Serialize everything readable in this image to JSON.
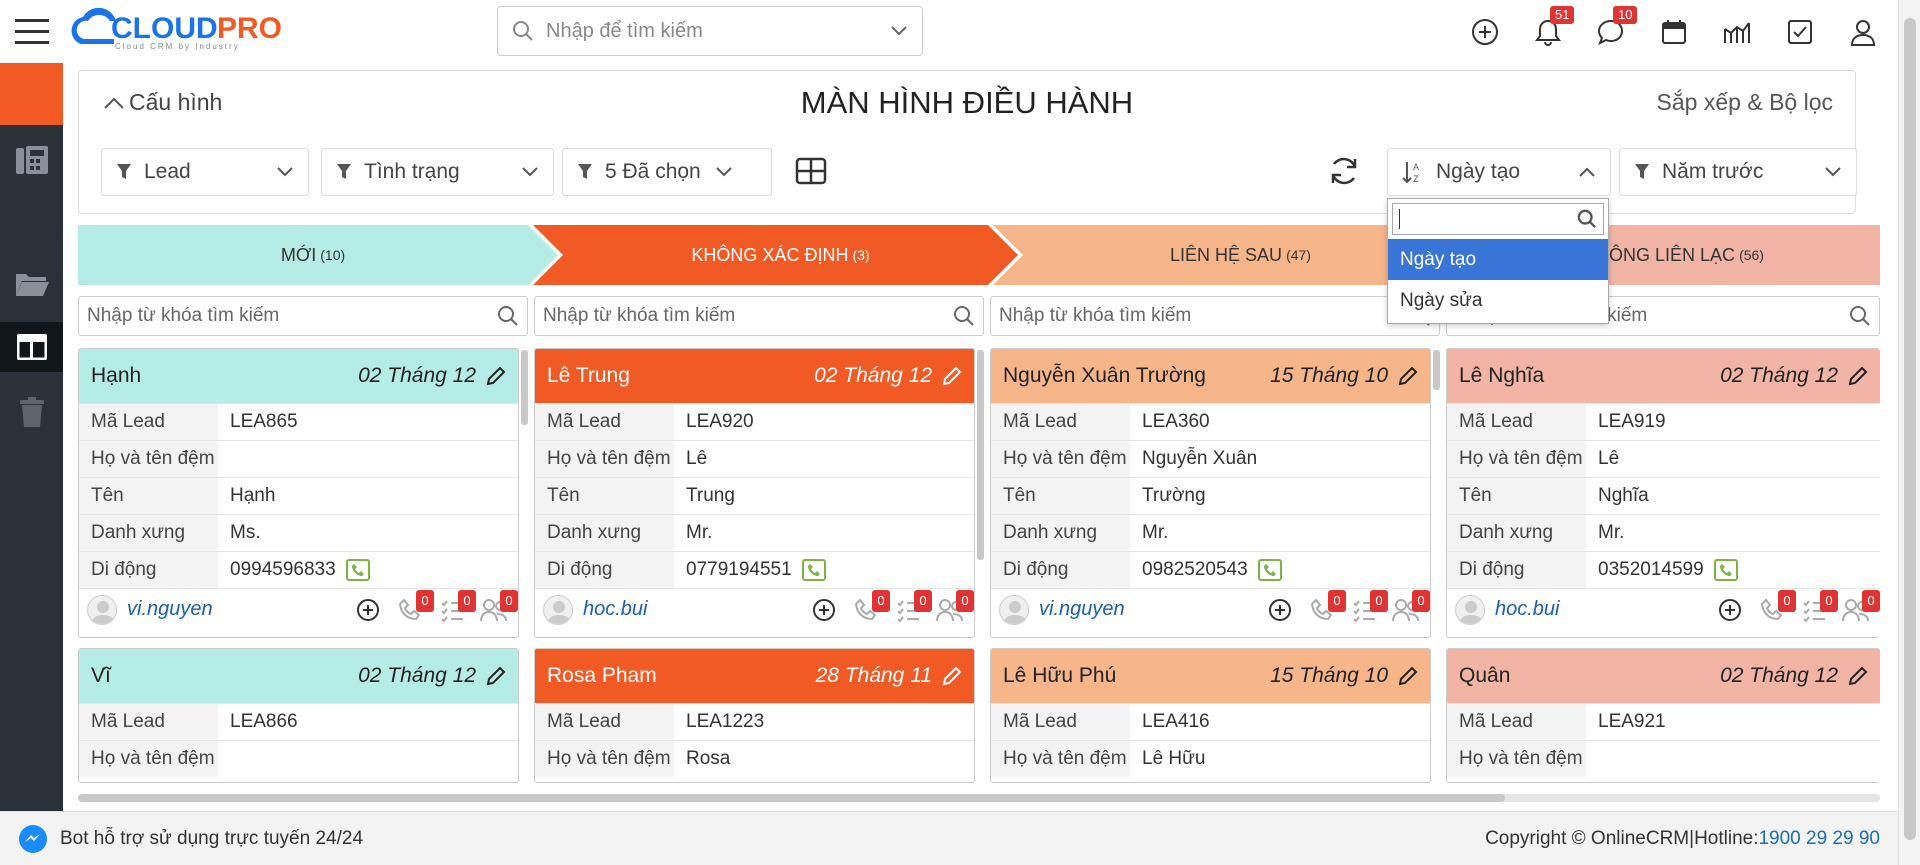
{
  "app": {
    "logo_text": "CLOUDPRO",
    "logo_tagline": "Cloud CRM by Industry"
  },
  "search": {
    "placeholder": "Nhập để tìm kiếm"
  },
  "header_icons": [
    {
      "name": "add-icon"
    },
    {
      "name": "bell-icon",
      "badge": "51"
    },
    {
      "name": "chat-icon",
      "badge": "10"
    },
    {
      "name": "calendar-icon"
    },
    {
      "name": "chart-icon"
    },
    {
      "name": "task-icon"
    },
    {
      "name": "user-icon"
    }
  ],
  "panel": {
    "config_label": "Cấu hình",
    "title": "MÀN HÌNH ĐIỀU HÀNH",
    "sort_filter_label": "Sắp xếp & Bộ lọc",
    "filters": [
      "Lead",
      "Tình trạng",
      "5 Đã chọn"
    ],
    "sort_field": "Ngày tạo",
    "time_filter": "Năm trước"
  },
  "sort_dropdown": {
    "options": [
      "Ngày tạo",
      "Ngày sửa"
    ],
    "selected": "Ngày tạo"
  },
  "stages": [
    {
      "label": "MỚI",
      "count": "(10)",
      "color": "#b5ece6"
    },
    {
      "label": "KHÔNG XÁC ĐỊNH",
      "count": "(3)",
      "color": "#f15a24"
    },
    {
      "label": "LIÊN HỆ SAU",
      "count": "(47)",
      "color": "#f7b68a"
    },
    {
      "label": "KHÔNG LIÊN LẠC",
      "count": "(56)",
      "color": "#f2b4a5"
    }
  ],
  "column_search_placeholder": "Nhập từ khóa tìm kiếm",
  "field_labels": {
    "code": "Mã Lead",
    "middle": "Họ và tên đệm",
    "first": "Tên",
    "salutation": "Danh xưng",
    "mobile": "Di động"
  },
  "columns": [
    {
      "cards": [
        {
          "name": "Hạnh",
          "date": "02 Tháng 12",
          "code": "LEA865",
          "middle": "",
          "first": "Hạnh",
          "salutation": "Ms.",
          "mobile": "0994596833",
          "owner": "vi.nguyen",
          "calls": "0",
          "tasks": "0",
          "meetings": "0"
        },
        {
          "name": "Vĩ",
          "date": "02 Tháng 12",
          "code": "LEA866",
          "middle": ""
        }
      ]
    },
    {
      "cards": [
        {
          "name": "Lê Trung",
          "date": "02 Tháng 12",
          "code": "LEA920",
          "middle": "Lê",
          "first": "Trung",
          "salutation": "Mr.",
          "mobile": "0779194551",
          "owner": "hoc.bui",
          "calls": "0",
          "tasks": "0",
          "meetings": "0"
        },
        {
          "name": "Rosa Pham",
          "date": "28 Tháng 11",
          "code": "LEA1223",
          "middle": "Rosa"
        }
      ]
    },
    {
      "cards": [
        {
          "name": "Nguyễn Xuân Trường",
          "date": "15 Tháng 10",
          "code": "LEA360",
          "middle": "Nguyễn Xuân",
          "first": "Trường",
          "salutation": "Mr.",
          "mobile": "0982520543",
          "owner": "vi.nguyen",
          "calls": "0",
          "tasks": "0",
          "meetings": "0"
        },
        {
          "name": "Lê Hữu Phú",
          "date": "15 Tháng 10",
          "code": "LEA416",
          "middle": "Lê Hữu"
        }
      ]
    },
    {
      "cards": [
        {
          "name": "Lê Nghĩa",
          "date": "02 Tháng 12",
          "code": "LEA919",
          "middle": "Lê",
          "first": "Nghĩa",
          "salutation": "Mr.",
          "mobile": "0352014599",
          "owner": "hoc.bui",
          "calls": "0",
          "tasks": "0",
          "meetings": "0"
        },
        {
          "name": "Quân",
          "date": "02 Tháng 12",
          "code": "LEA921",
          "middle": ""
        }
      ]
    }
  ],
  "footer": {
    "bot_text": "Bot hỗ trợ sử dụng trực tuyến 24/24",
    "copyright": "Copyright © OnlineCRM|Hotline: ",
    "hotline": "1900 29 29 90"
  }
}
